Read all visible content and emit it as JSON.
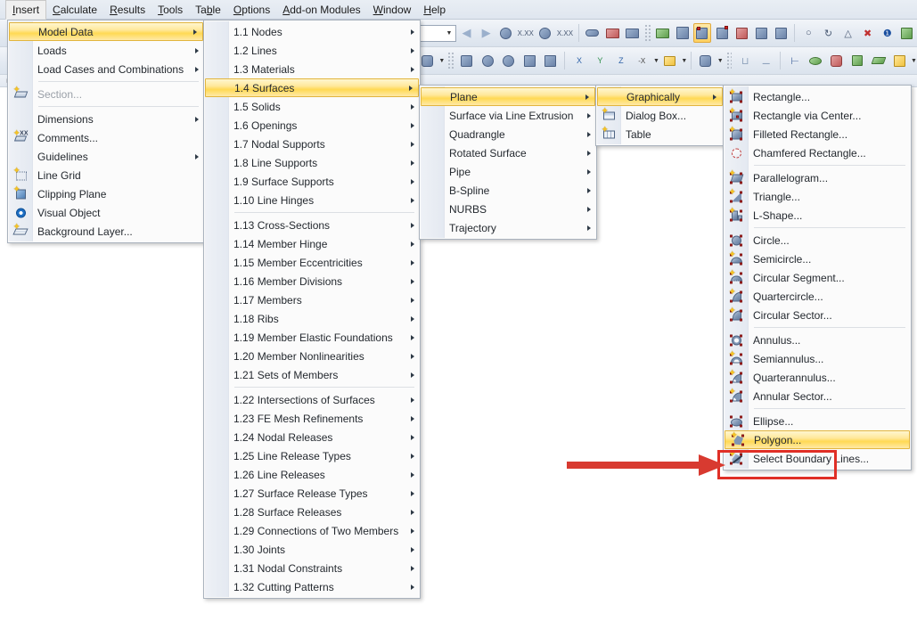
{
  "menubar": {
    "items": [
      {
        "label": "Insert",
        "mnemonic": "I",
        "active": true
      },
      {
        "label": "Calculate",
        "mnemonic": "C",
        "active": false
      },
      {
        "label": "Results",
        "mnemonic": "R",
        "active": false
      },
      {
        "label": "Tools",
        "mnemonic": "T",
        "active": false
      },
      {
        "label": "Table",
        "mnemonic": "b",
        "active": false
      },
      {
        "label": "Options",
        "mnemonic": "O",
        "active": false
      },
      {
        "label": "Add-on Modules",
        "mnemonic": "A",
        "active": false
      },
      {
        "label": "Window",
        "mnemonic": "W",
        "active": false
      },
      {
        "label": "Help",
        "mnemonic": "H",
        "active": false
      }
    ]
  },
  "insert_menu": {
    "name": "Insert",
    "items": [
      {
        "label": "Model Data",
        "submenu": true,
        "selected": true,
        "icon": null,
        "disabled": false
      },
      {
        "label": "Loads",
        "submenu": true,
        "selected": false,
        "icon": null,
        "disabled": false
      },
      {
        "label": "Load Cases and Combinations",
        "submenu": true,
        "selected": false,
        "icon": null,
        "disabled": false
      },
      {
        "separator": true
      },
      {
        "label": "Section...",
        "submenu": false,
        "selected": false,
        "icon": "section-icon",
        "disabled": true
      },
      {
        "separator": true
      },
      {
        "label": "Dimensions",
        "submenu": true,
        "selected": false,
        "icon": null,
        "disabled": false
      },
      {
        "label": "Comments...",
        "submenu": false,
        "selected": false,
        "icon": "comment-icon",
        "disabled": false
      },
      {
        "label": "Guidelines",
        "submenu": true,
        "selected": false,
        "icon": null,
        "disabled": false
      },
      {
        "label": "Line Grid",
        "submenu": false,
        "selected": false,
        "icon": "line-grid-icon",
        "disabled": false
      },
      {
        "label": "Clipping Plane",
        "submenu": false,
        "selected": false,
        "icon": "clipping-plane-icon",
        "disabled": false
      },
      {
        "label": "Visual Object",
        "submenu": false,
        "selected": false,
        "icon": "visual-object-icon",
        "disabled": false
      },
      {
        "label": "Background Layer...",
        "submenu": false,
        "selected": false,
        "icon": "background-layer-icon",
        "disabled": false
      }
    ]
  },
  "model_data_menu": {
    "name": "Model Data",
    "items": [
      {
        "label": "1.1 Nodes",
        "submenu": true,
        "selected": false
      },
      {
        "label": "1.2 Lines",
        "submenu": true,
        "selected": false
      },
      {
        "label": "1.3 Materials",
        "submenu": true,
        "selected": false
      },
      {
        "label": "1.4 Surfaces",
        "submenu": true,
        "selected": true
      },
      {
        "label": "1.5 Solids",
        "submenu": true,
        "selected": false
      },
      {
        "label": "1.6 Openings",
        "submenu": true,
        "selected": false
      },
      {
        "label": "1.7 Nodal Supports",
        "submenu": true,
        "selected": false
      },
      {
        "label": "1.8 Line Supports",
        "submenu": true,
        "selected": false
      },
      {
        "label": "1.9 Surface Supports",
        "submenu": true,
        "selected": false
      },
      {
        "label": "1.10 Line Hinges",
        "submenu": true,
        "selected": false
      },
      {
        "separator": true
      },
      {
        "label": "1.13 Cross-Sections",
        "submenu": true,
        "selected": false
      },
      {
        "label": "1.14 Member Hinge",
        "submenu": true,
        "selected": false
      },
      {
        "label": "1.15 Member Eccentricities",
        "submenu": true,
        "selected": false
      },
      {
        "label": "1.16 Member Divisions",
        "submenu": true,
        "selected": false
      },
      {
        "label": "1.17 Members",
        "submenu": true,
        "selected": false
      },
      {
        "label": "1.18 Ribs",
        "submenu": true,
        "selected": false
      },
      {
        "label": "1.19 Member Elastic Foundations",
        "submenu": true,
        "selected": false
      },
      {
        "label": "1.20 Member Nonlinearities",
        "submenu": true,
        "selected": false
      },
      {
        "label": "1.21 Sets of Members",
        "submenu": true,
        "selected": false
      },
      {
        "separator": true
      },
      {
        "label": "1.22 Intersections of Surfaces",
        "submenu": true,
        "selected": false
      },
      {
        "label": "1.23 FE Mesh Refinements",
        "submenu": true,
        "selected": false
      },
      {
        "label": "1.24 Nodal Releases",
        "submenu": true,
        "selected": false
      },
      {
        "label": "1.25 Line Release Types",
        "submenu": true,
        "selected": false
      },
      {
        "label": "1.26 Line Releases",
        "submenu": true,
        "selected": false
      },
      {
        "label": "1.27 Surface Release Types",
        "submenu": true,
        "selected": false
      },
      {
        "label": "1.28 Surface Releases",
        "submenu": true,
        "selected": false
      },
      {
        "label": "1.29 Connections of Two Members",
        "submenu": true,
        "selected": false
      },
      {
        "label": "1.30 Joints",
        "submenu": true,
        "selected": false
      },
      {
        "label": "1.31 Nodal Constraints",
        "submenu": true,
        "selected": false
      },
      {
        "label": "1.32 Cutting Patterns",
        "submenu": true,
        "selected": false
      }
    ]
  },
  "surfaces_menu": {
    "name": "Surfaces",
    "items": [
      {
        "label": "Plane",
        "submenu": true,
        "selected": true
      },
      {
        "label": "Surface via Line Extrusion",
        "submenu": true,
        "selected": false
      },
      {
        "label": "Quadrangle",
        "submenu": true,
        "selected": false
      },
      {
        "label": "Rotated Surface",
        "submenu": true,
        "selected": false
      },
      {
        "label": "Pipe",
        "submenu": true,
        "selected": false
      },
      {
        "label": "B-Spline",
        "submenu": true,
        "selected": false
      },
      {
        "label": "NURBS",
        "submenu": true,
        "selected": false
      },
      {
        "label": "Trajectory",
        "submenu": true,
        "selected": false
      }
    ]
  },
  "plane_menu": {
    "name": "Plane",
    "items": [
      {
        "label": "Graphically",
        "submenu": true,
        "selected": true,
        "icon": null
      },
      {
        "label": "Dialog Box...",
        "submenu": false,
        "selected": false,
        "icon": "dialog-box-icon"
      },
      {
        "label": "Table",
        "submenu": false,
        "selected": false,
        "icon": "table-icon"
      }
    ]
  },
  "graphically_menu": {
    "name": "Graphically",
    "items": [
      {
        "label": "Rectangle...",
        "icon": "rectangle-icon",
        "selected": false
      },
      {
        "label": "Rectangle via Center...",
        "icon": "rectangle-via-center-icon",
        "selected": false
      },
      {
        "label": "Filleted Rectangle...",
        "icon": "filleted-rectangle-icon",
        "selected": false
      },
      {
        "label": "Chamfered Rectangle...",
        "icon": "chamfered-rectangle-icon",
        "selected": false
      },
      {
        "separator": true
      },
      {
        "label": "Parallelogram...",
        "icon": "parallelogram-icon",
        "selected": false
      },
      {
        "label": "Triangle...",
        "icon": "triangle-icon",
        "selected": false
      },
      {
        "label": "L-Shape...",
        "icon": "l-shape-icon",
        "selected": false
      },
      {
        "separator": true
      },
      {
        "label": "Circle...",
        "icon": "circle-icon",
        "selected": false
      },
      {
        "label": "Semicircle...",
        "icon": "semicircle-icon",
        "selected": false
      },
      {
        "label": "Circular Segment...",
        "icon": "circular-segment-icon",
        "selected": false
      },
      {
        "label": "Quartercircle...",
        "icon": "quartercircle-icon",
        "selected": false
      },
      {
        "label": "Circular Sector...",
        "icon": "circular-sector-icon",
        "selected": false
      },
      {
        "separator": true
      },
      {
        "label": "Annulus...",
        "icon": "annulus-icon",
        "selected": false
      },
      {
        "label": "Semiannulus...",
        "icon": "semiannulus-icon",
        "selected": false
      },
      {
        "label": "Quarterannulus...",
        "icon": "quarterannulus-icon",
        "selected": false
      },
      {
        "label": "Annular Sector...",
        "icon": "annular-sector-icon",
        "selected": false
      },
      {
        "separator": true
      },
      {
        "label": "Ellipse...",
        "icon": "ellipse-icon",
        "selected": false
      },
      {
        "label": "Polygon...",
        "icon": "polygon-icon",
        "selected": true,
        "annotated": true
      },
      {
        "label": "Select Boundary Lines...",
        "icon": "select-boundary-lines-icon",
        "selected": false
      }
    ]
  },
  "annotation": {
    "highlight_target": "Polygon...",
    "box_color": "#e02f26",
    "arrow_color": "#d83a30"
  },
  "colors": {
    "menu_highlight_top": "#fff6cf",
    "menu_highlight_mid": "#ffd954",
    "menu_highlight_border": "#e2b53e",
    "menu_bg": "#fbfbfb",
    "menu_border": "#a9b2bd",
    "gutter": "#e9eef5",
    "text": "#24292f",
    "disabled_text": "#9aa0a8",
    "toolbar_bg": "#e4eaf2"
  },
  "toolbar": {
    "combo_value": "",
    "rows": 3
  }
}
